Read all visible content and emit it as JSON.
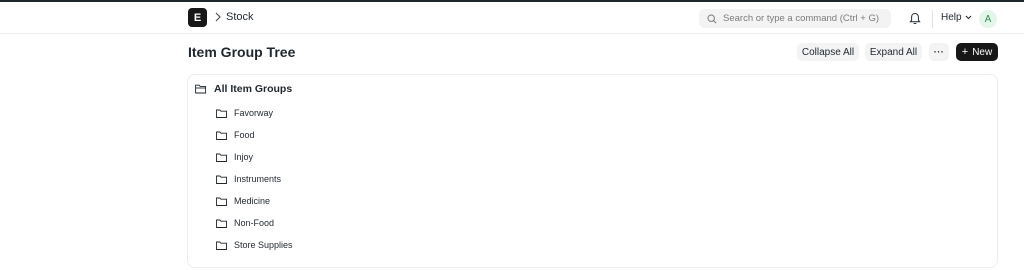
{
  "navbar": {
    "logo_letter": "E",
    "breadcrumb": "Stock",
    "search_placeholder": "Search or type a command (Ctrl + G)",
    "help_label": "Help",
    "avatar_initial": "A"
  },
  "page": {
    "title": "Item Group Tree",
    "actions": {
      "collapse_all": "Collapse All",
      "expand_all": "Expand All",
      "more": "···",
      "new_label": "New",
      "new_icon": "+"
    }
  },
  "tree": {
    "root_label": "All Item Groups",
    "children": [
      {
        "label": "Favorway"
      },
      {
        "label": "Food"
      },
      {
        "label": "Injoy"
      },
      {
        "label": "Instruments"
      },
      {
        "label": "Medicine"
      },
      {
        "label": "Non-Food"
      },
      {
        "label": "Store Supplies"
      }
    ]
  },
  "colors": {
    "text": "#1f272e",
    "button_bg": "#f3f3f3",
    "primary_bg": "#171717",
    "avatar_bg": "#e4f5e9",
    "avatar_text": "#2f8f4e"
  },
  "icons": {
    "logo": "erp-logo-icon",
    "breadcrumb_separator": "chevron-right-icon",
    "search": "search-icon",
    "notifications": "bell-icon",
    "help_dropdown": "chevron-down-icon",
    "root": "folder-open-icon",
    "child": "folder-icon"
  }
}
